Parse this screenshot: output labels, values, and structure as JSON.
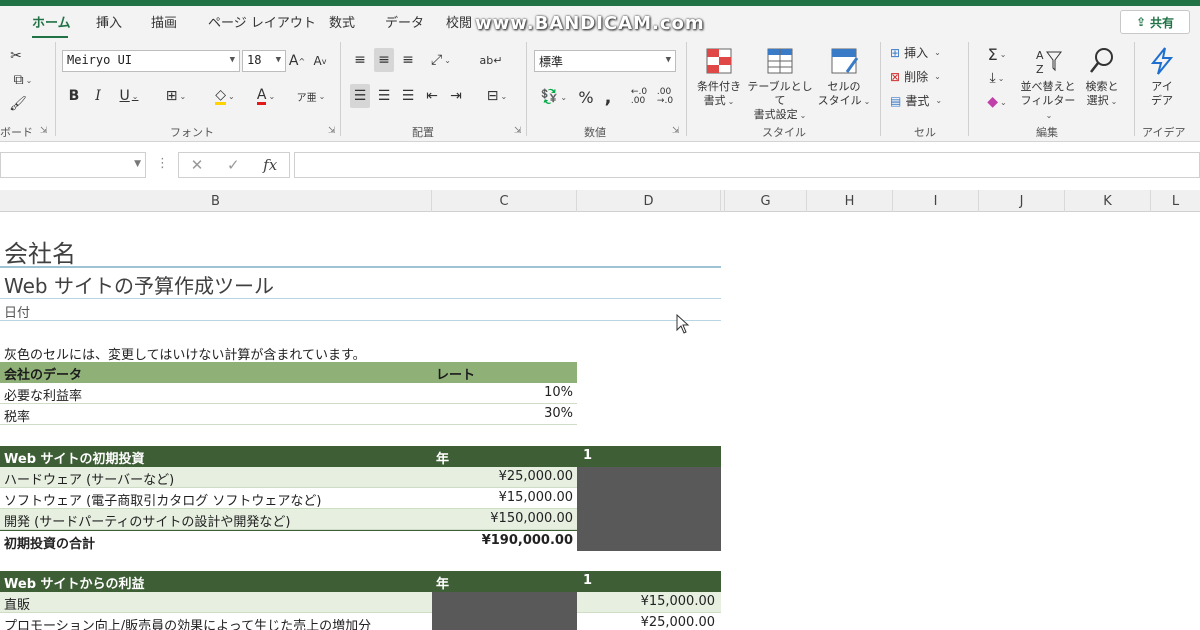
{
  "menu": {
    "tabs": [
      "ホーム",
      "挿入",
      "描画",
      "ページ レイアウト",
      "数式",
      "データ",
      "校閲"
    ],
    "active": "ホーム",
    "share": "共有",
    "watermark": "www.BANDICAM.com"
  },
  "ribbon": {
    "clipboard_label": "ボード",
    "font_label": "フォント",
    "font_name": "Meiryo UI",
    "font_size": "18",
    "align_label": "配置",
    "number_label": "数値",
    "number_format": "標準",
    "style_label": "スタイル",
    "cond_format": [
      "条件付き",
      "書式"
    ],
    "table_format": [
      "テーブルとして",
      "書式設定"
    ],
    "cell_style": [
      "セルの",
      "スタイル"
    ],
    "cells_label": "セル",
    "insert": "挿入",
    "delete": "削除",
    "format": "書式",
    "edit_label": "編集",
    "sort_filter": [
      "並べ替えと",
      "フィルター"
    ],
    "find_select": [
      "検索と",
      "選択"
    ],
    "ideas": [
      "アイ",
      "デア"
    ],
    "ideas_label": "アイデア"
  },
  "formula_bar": {
    "fx": "fx",
    "value": ""
  },
  "columns": [
    "B",
    "C",
    "D",
    "G",
    "H",
    "I",
    "J",
    "K",
    "L"
  ],
  "sheet": {
    "company": "会社名",
    "title": "Web サイトの予算作成ツール",
    "date": "日付",
    "note": "灰色のセルには、変更してはいけない計算が含まれています。",
    "company_data": {
      "header": "会社のデータ",
      "rate_header": "レート",
      "rows": [
        {
          "label": "必要な利益率",
          "value": "10%"
        },
        {
          "label": "税率",
          "value": "30%"
        }
      ]
    },
    "investment": {
      "header": "Web サイトの初期投資",
      "year_header": "年",
      "year": "1",
      "rows": [
        {
          "label": "ハードウェア (サーバーなど)",
          "value": "¥25,000.00"
        },
        {
          "label": "ソフトウェア (電子商取引カタログ ソフトウェアなど)",
          "value": "¥15,000.00"
        },
        {
          "label": "開発 (サードパーティのサイトの設計や開発など)",
          "value": "¥150,000.00"
        }
      ],
      "total_label": "初期投資の合計",
      "total_value": "¥190,000.00"
    },
    "profit": {
      "header": "Web サイトからの利益",
      "year_header": "年",
      "year": "1",
      "rows": [
        {
          "label": "直販",
          "value": "¥15,000.00"
        },
        {
          "label": "プロモーション向上/販売員の効果によって生じた売上の増加分",
          "value": "¥25,000.00"
        }
      ]
    }
  }
}
